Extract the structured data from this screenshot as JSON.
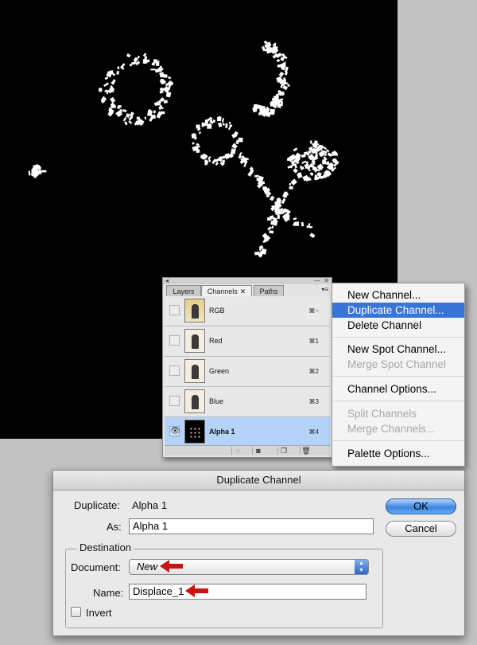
{
  "palette": {
    "tabs": [
      {
        "label": "Layers"
      },
      {
        "label": "Channels",
        "close": "✕"
      },
      {
        "label": "Paths"
      }
    ],
    "menu_icon": "▾≡",
    "channels": [
      {
        "label": "RGB",
        "shortcut": "⌘~",
        "visible": false,
        "selected": false
      },
      {
        "label": "Red",
        "shortcut": "⌘1",
        "visible": false,
        "selected": false
      },
      {
        "label": "Green",
        "shortcut": "⌘2",
        "visible": false,
        "selected": false
      },
      {
        "label": "Blue",
        "shortcut": "⌘3",
        "visible": false,
        "selected": false
      },
      {
        "label": "Alpha 1",
        "shortcut": "⌘4",
        "visible": true,
        "selected": true
      }
    ],
    "bottom_icons": [
      "load-selection-icon",
      "save-selection-icon",
      "new-channel-icon",
      "trash-icon"
    ]
  },
  "menu": {
    "items": [
      {
        "label": "New Channel...",
        "state": "normal"
      },
      {
        "label": "Duplicate Channel...",
        "state": "highlighted"
      },
      {
        "label": "Delete Channel",
        "state": "normal"
      },
      {
        "label": "New Spot Channel...",
        "state": "normal"
      },
      {
        "label": "Merge Spot Channel",
        "state": "disabled"
      },
      {
        "label": "Channel Options...",
        "state": "normal"
      },
      {
        "label": "Split Channels",
        "state": "disabled"
      },
      {
        "label": "Merge Channels...",
        "state": "disabled"
      },
      {
        "label": "Palette Options...",
        "state": "normal"
      }
    ]
  },
  "dialog": {
    "title": "Duplicate Channel",
    "duplicate_label": "Duplicate:",
    "duplicate_value": "Alpha 1",
    "as_label": "As:",
    "as_value": "Alpha 1",
    "destination_label": "Destination",
    "document_label": "Document:",
    "document_value": "New",
    "name_label": "Name:",
    "name_value": "Displace_1",
    "invert_label": "Invert",
    "invert_checked": false,
    "ok_label": "OK",
    "cancel_label": "Cancel"
  },
  "colors": {
    "menu_highlight": "#3875d7",
    "selected_row": "#b5d3fa",
    "annotation_arrow": "#cc1111"
  }
}
